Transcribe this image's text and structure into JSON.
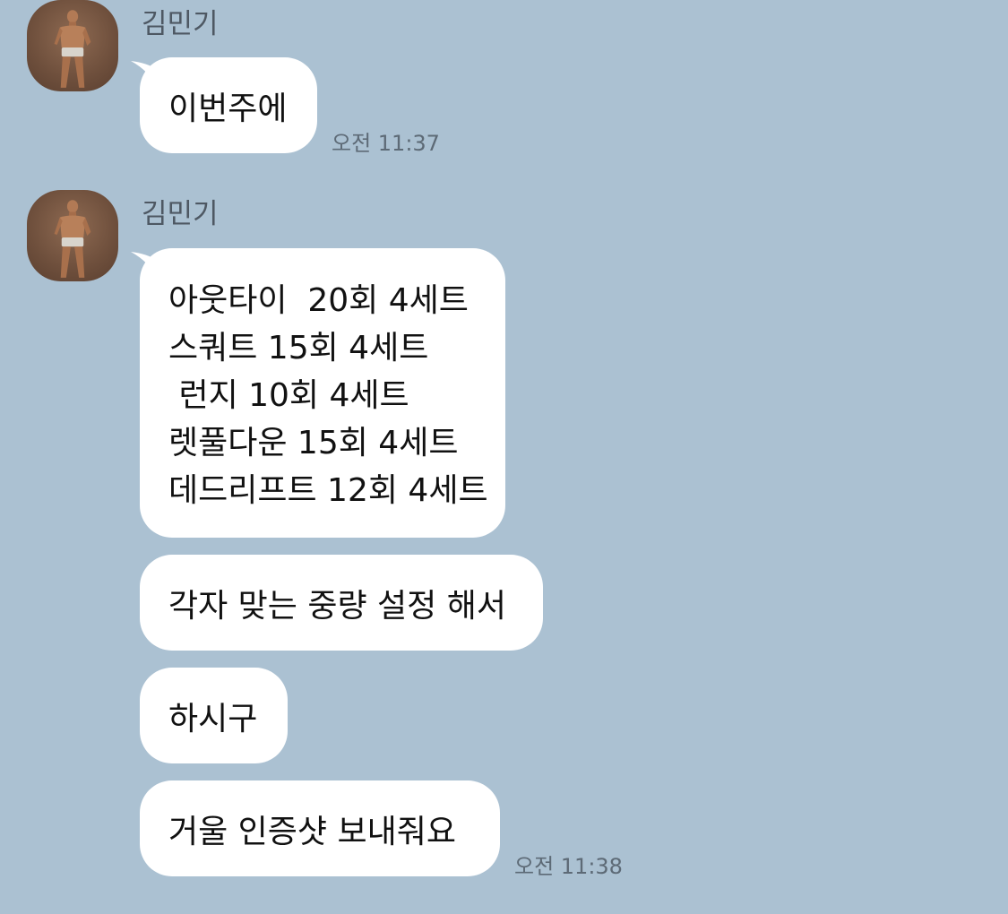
{
  "messages": [
    {
      "sender": "김민기",
      "bubbles": [
        "이번주에"
      ],
      "time": "오전 11:37"
    },
    {
      "sender": "김민기",
      "bubbles": [
        "아웃타이  20회 4세트\n스쿼트 15회 4세트\n 런지 10회 4세트\n렛풀다운 15회 4세트\n데드리프트 12회 4세트",
        "각자 맞는 중량 설정 해서",
        "하시구",
        "거울 인증샷 보내줘요"
      ],
      "time": "오전 11:38"
    }
  ],
  "colors": {
    "background": "#abc1d2",
    "bubble": "#ffffff",
    "sender_text": "#4e5863",
    "time_text": "#5d6a76"
  },
  "icons": {
    "avatar": "profile-photo-icon"
  }
}
